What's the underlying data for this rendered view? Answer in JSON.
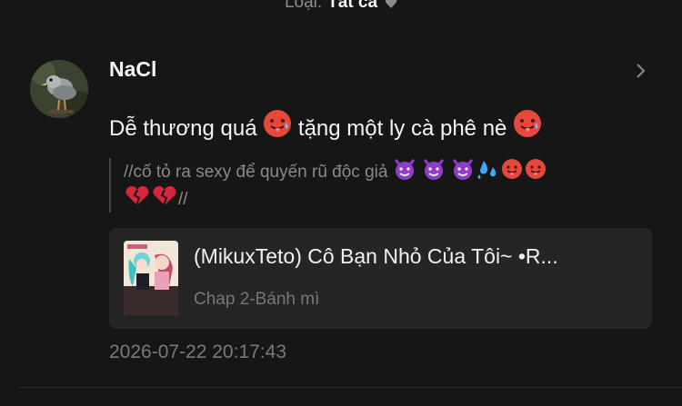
{
  "filter": {
    "label": "Loại:",
    "value": "Tất cả",
    "icon": "heart-icon"
  },
  "comment": {
    "username": "NaCl",
    "text_part1": "Dễ thương quá ",
    "text_part2": " tặng một ly cà phê nè ",
    "quote_part1": "//cố tỏ ra sexy để quyến rũ độc giả ",
    "quote_end": "//",
    "timestamp": "2026-07-22 20:17:43"
  },
  "story": {
    "title": "(MikuxTeto) Cô Bạn Nhỏ Của Tôi~ •R...",
    "chapter": "Chap 2-Bánh mì"
  },
  "icons": {
    "avatar": "bird-avatar",
    "chevron": "chevron-right-icon",
    "hot_face": "hot-face-emoji",
    "devil": "smiling-devil-emoji",
    "sweat": "sweat-droplets-emoji",
    "broken_heart": "broken-heart-emoji"
  },
  "colors": {
    "background": "#161616",
    "card": "#252525",
    "muted_text": "#8a8a8a",
    "devil_purple": "#8e3ec9",
    "hot_face_red": "#e8483a",
    "broken_heart_red": "#d7263d"
  }
}
